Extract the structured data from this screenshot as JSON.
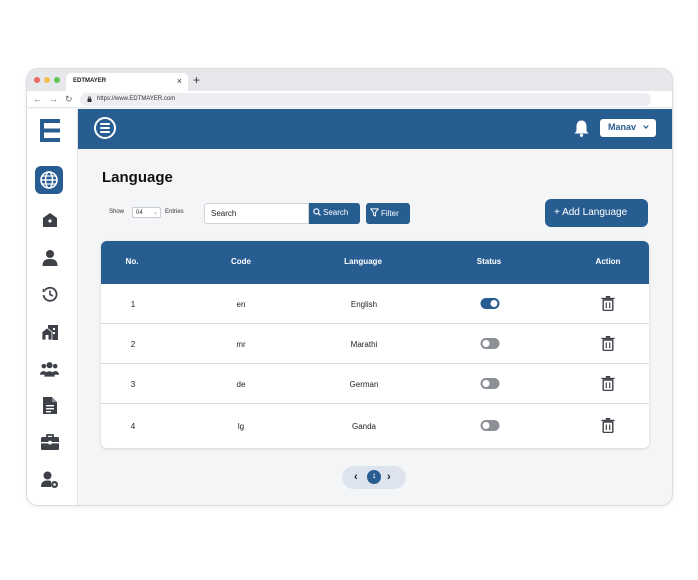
{
  "browser": {
    "tab_title": "EDTMAYER",
    "tab_close": "×",
    "new_tab": "+",
    "url": "https://www.EDTMAYER.com",
    "nav": {
      "back": "←",
      "forward": "→",
      "reload": "↻"
    }
  },
  "sidebar": {
    "items": [
      {
        "icon": "globe-icon",
        "active": true
      },
      {
        "icon": "house-icon",
        "active": false
      },
      {
        "icon": "user-icon",
        "active": false
      },
      {
        "icon": "history-icon",
        "active": false
      },
      {
        "icon": "building-icon",
        "active": false
      },
      {
        "icon": "users-icon",
        "active": false
      },
      {
        "icon": "document-icon",
        "active": false
      },
      {
        "icon": "briefcase-icon",
        "active": false
      },
      {
        "icon": "user-settings-icon",
        "active": false
      }
    ]
  },
  "header": {
    "user_name": "Manav"
  },
  "page": {
    "title": "Language",
    "show_label": "Show",
    "entries_value": "04",
    "entries_label": "Entries",
    "search_value": "Search",
    "search_button": "Search",
    "filter_button": "Filter",
    "add_button": "+ Add Language"
  },
  "table": {
    "headers": [
      "No.",
      "Code",
      "Language",
      "Status",
      "Action"
    ],
    "rows": [
      {
        "no": "1",
        "code": "en",
        "language": "English",
        "status": true
      },
      {
        "no": "2",
        "code": "mr",
        "language": "Marathi",
        "status": false
      },
      {
        "no": "3",
        "code": "de",
        "language": "German",
        "status": false
      },
      {
        "no": "4",
        "code": "lg",
        "language": "Ganda",
        "status": false
      }
    ]
  },
  "pagination": {
    "prev": "‹",
    "current": "1",
    "next": "›"
  },
  "colors": {
    "primary": "#285d92",
    "toggle_off": "#8c9096",
    "background": "#f4f5f7"
  }
}
